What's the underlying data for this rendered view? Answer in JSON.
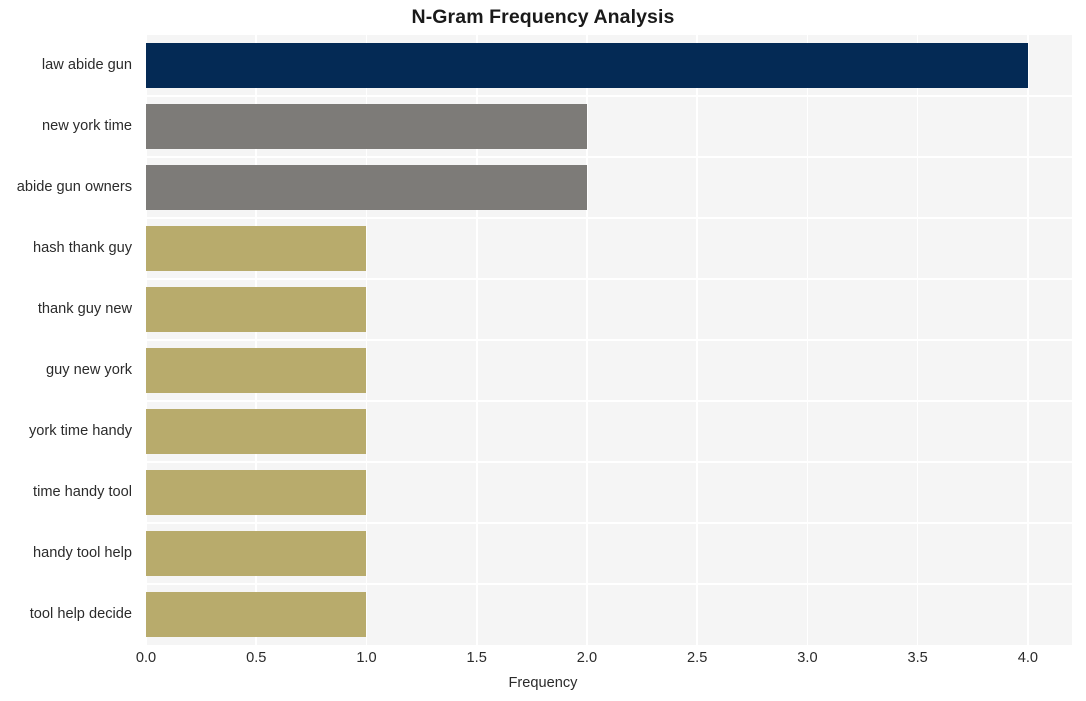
{
  "chart_data": {
    "type": "bar",
    "orientation": "horizontal",
    "title": "N-Gram Frequency Analysis",
    "xlabel": "Frequency",
    "ylabel": "",
    "categories": [
      "law abide gun",
      "new york time",
      "abide gun owners",
      "hash thank guy",
      "thank guy new",
      "guy new york",
      "york time handy",
      "time handy tool",
      "handy tool help",
      "tool help decide"
    ],
    "values": [
      4.0,
      2.0,
      2.0,
      1.0,
      1.0,
      1.0,
      1.0,
      1.0,
      1.0,
      1.0
    ],
    "bar_colors": [
      "#042a55",
      "#7d7b78",
      "#7d7b78",
      "#b8ab6c",
      "#b8ab6c",
      "#b8ab6c",
      "#b8ab6c",
      "#b8ab6c",
      "#b8ab6c",
      "#b8ab6c"
    ],
    "xlim": [
      0.0,
      4.2
    ],
    "xticks": [
      "0.0",
      "0.5",
      "1.0",
      "1.5",
      "2.0",
      "2.5",
      "3.0",
      "3.5",
      "4.0"
    ],
    "xtick_values": [
      0.0,
      0.5,
      1.0,
      1.5,
      2.0,
      2.5,
      3.0,
      3.5,
      4.0
    ],
    "grid": true,
    "grid_color": "#ffffff",
    "legend": "none",
    "plot_background": "#f5f5f5",
    "figure_background": "#ffffff"
  }
}
